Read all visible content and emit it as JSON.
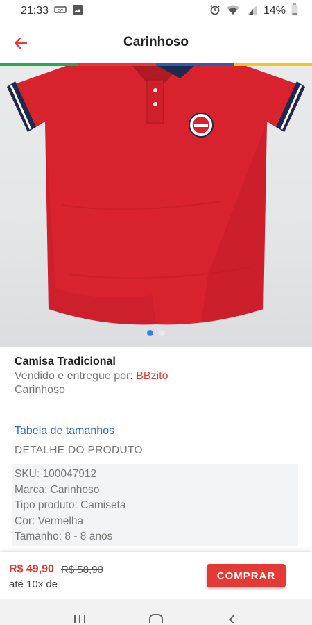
{
  "status_bar": {
    "time": "21:33",
    "battery": "14%"
  },
  "app_bar": {
    "title": "Carinhoso",
    "back_icon": "arrow-left-icon"
  },
  "stripe_colors": [
    "#2ba84a",
    "#e53935",
    "#2a5db0",
    "#f5c518"
  ],
  "carousel": {
    "pages": 2,
    "active": 0
  },
  "product": {
    "name": "Camisa Tradicional",
    "sold_by_label": "Vendido e entregue por: ",
    "seller": "BBzito",
    "brand": "Carinhoso"
  },
  "size_table_link": "Tabela de tamanhos",
  "detail_heading": "DETALHE DO PRODUTO",
  "details": [
    "SKU: 100047912",
    "Marca: Carinhoso",
    "Tipo produto: Camiseta",
    "Cor: Vermelha",
    "Tamanho: 8 - 8 anos"
  ],
  "purchase": {
    "price": "R$ 49,90",
    "old_price": "R$ 58,90",
    "installments": "até 10x de",
    "buy_label": "COMPRAR"
  },
  "colors": {
    "accent": "#e53935",
    "link": "#2f6fd6",
    "dot_active": "#2f80ed"
  }
}
